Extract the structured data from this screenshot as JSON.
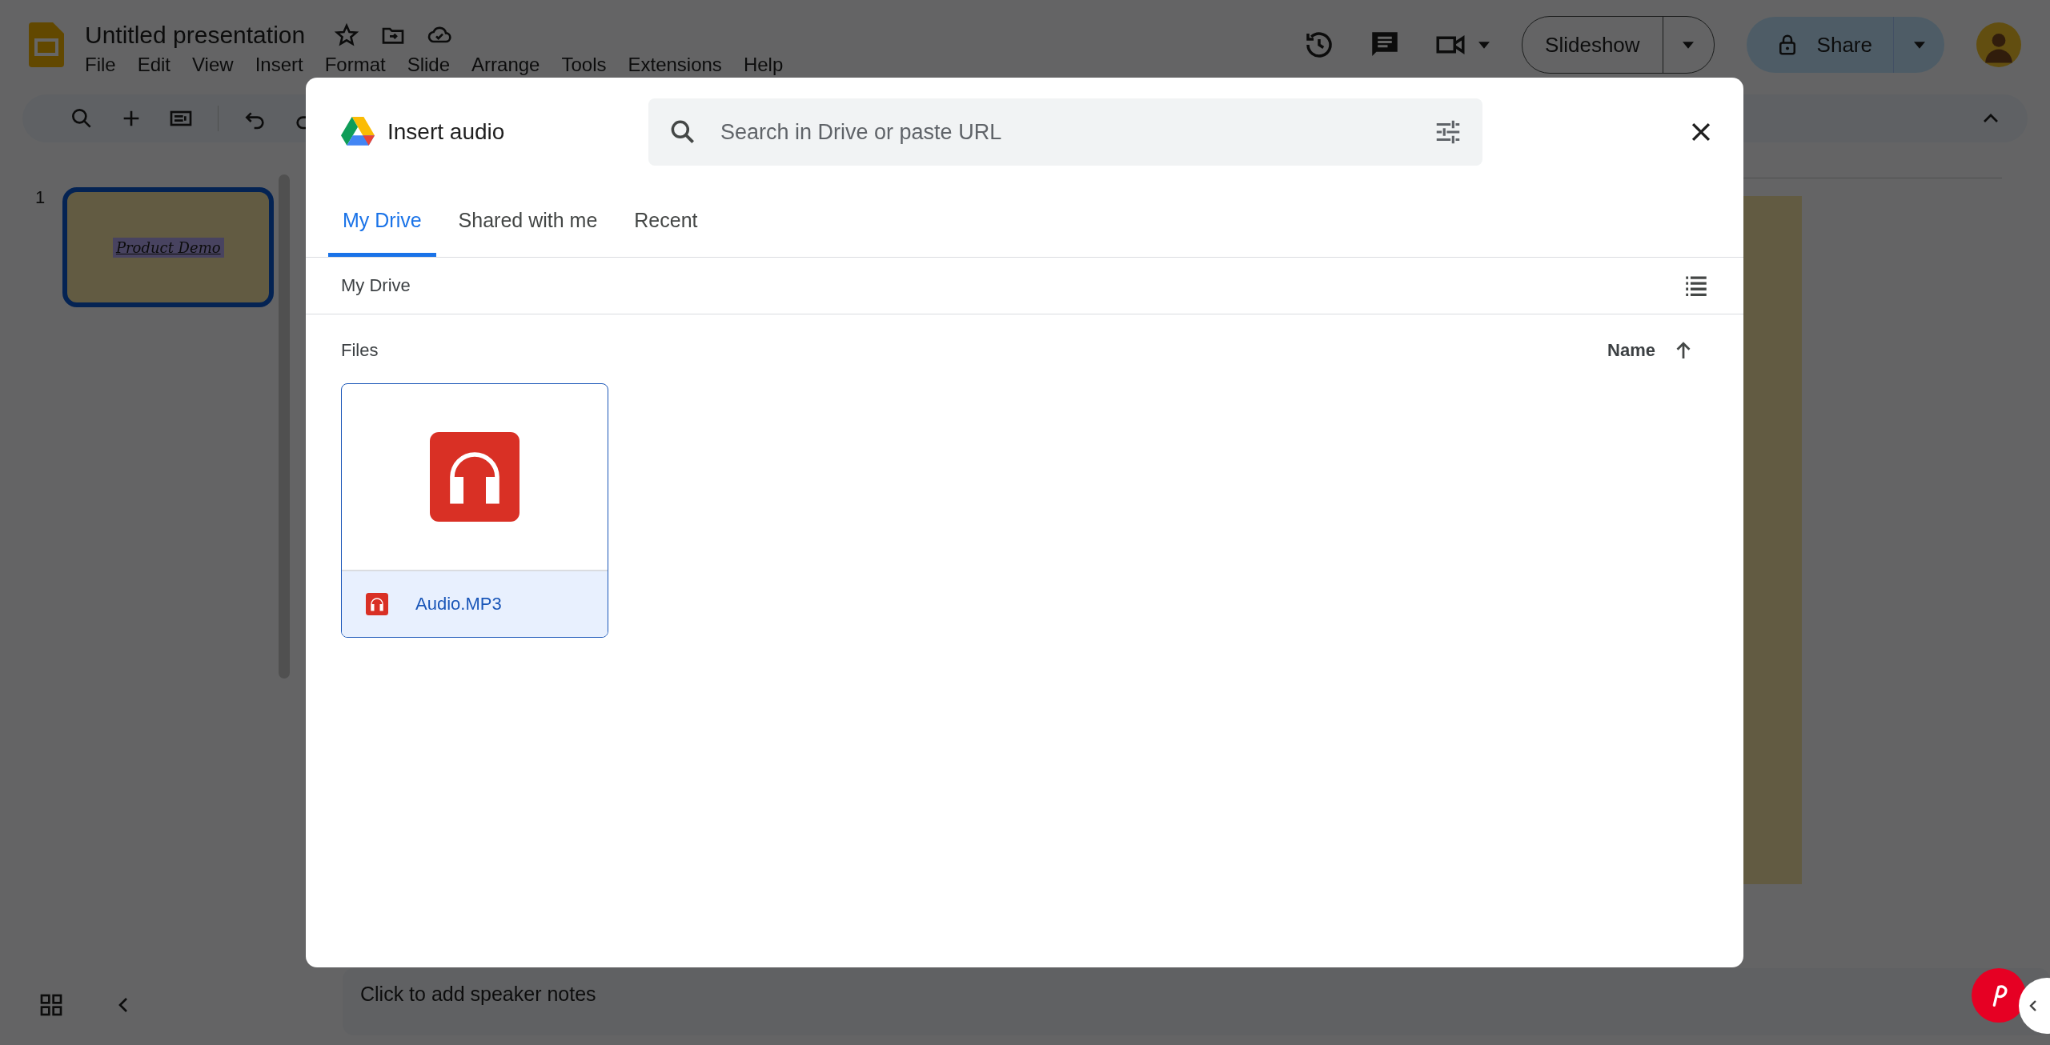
{
  "app": {
    "title": "Untitled presentation",
    "menu": [
      "File",
      "Edit",
      "View",
      "Insert",
      "Format",
      "Slide",
      "Arrange",
      "Tools",
      "Extensions",
      "Help"
    ],
    "slideshow_button": "Slideshow",
    "share_button": "Share"
  },
  "filmstrip": {
    "slides": [
      {
        "number": "1",
        "title": "Product Demo",
        "selected": true
      }
    ]
  },
  "notes": {
    "placeholder": "Click to add speaker notes"
  },
  "dialog": {
    "title": "Insert audio",
    "search": {
      "placeholder": "Search in Drive or paste URL"
    },
    "tabs": [
      {
        "label": "My Drive",
        "selected": true
      },
      {
        "label": "Shared with me",
        "selected": false
      },
      {
        "label": "Recent",
        "selected": false
      }
    ],
    "breadcrumb": "My Drive",
    "section": "Files",
    "sort": {
      "label": "Name"
    },
    "files": [
      {
        "name": "Audio.MP3",
        "selected": true
      }
    ]
  }
}
